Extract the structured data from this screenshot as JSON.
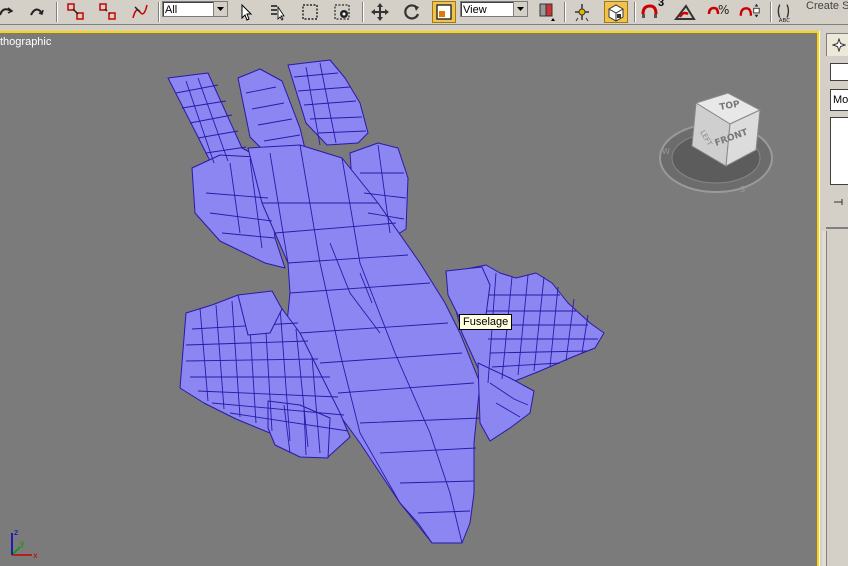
{
  "toolbar": {
    "selection_filter": "All",
    "reference_coord": "View",
    "snap_angle": "3",
    "create_selection_label": "Create S"
  },
  "viewport": {
    "label": "thographic",
    "tooltip": "Fuselage",
    "viewcube": {
      "top": "TOP",
      "front": "FRONT",
      "left": "LEFT"
    },
    "axis": {
      "x": "x",
      "y": "y",
      "z": "z"
    }
  },
  "command_panel": {
    "field_value": "Mo"
  },
  "colors": {
    "viewport_bg": "#7b7b7b",
    "active_border": "#ffd700",
    "mesh_fill": "#8080f0",
    "mesh_edge": "#2a1aa8"
  }
}
